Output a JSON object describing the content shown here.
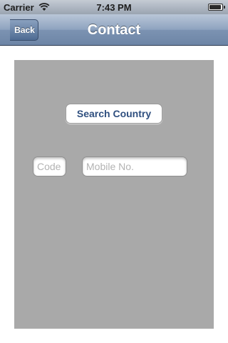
{
  "status_bar": {
    "carrier": "Carrier",
    "time": "7:43 PM",
    "wifi_icon": "wifi-icon",
    "battery_icon": "battery-icon"
  },
  "nav_bar": {
    "title": "Contact",
    "back_label": "Back"
  },
  "form": {
    "search_country_label": "Search Country",
    "code_placeholder": "Code",
    "mobile_placeholder": "Mobile No."
  },
  "colors": {
    "nav_bar": "#7c93b2",
    "panel": "#a9a9a9",
    "button_text": "#2f4f7f",
    "placeholder": "#b3b3b3"
  }
}
